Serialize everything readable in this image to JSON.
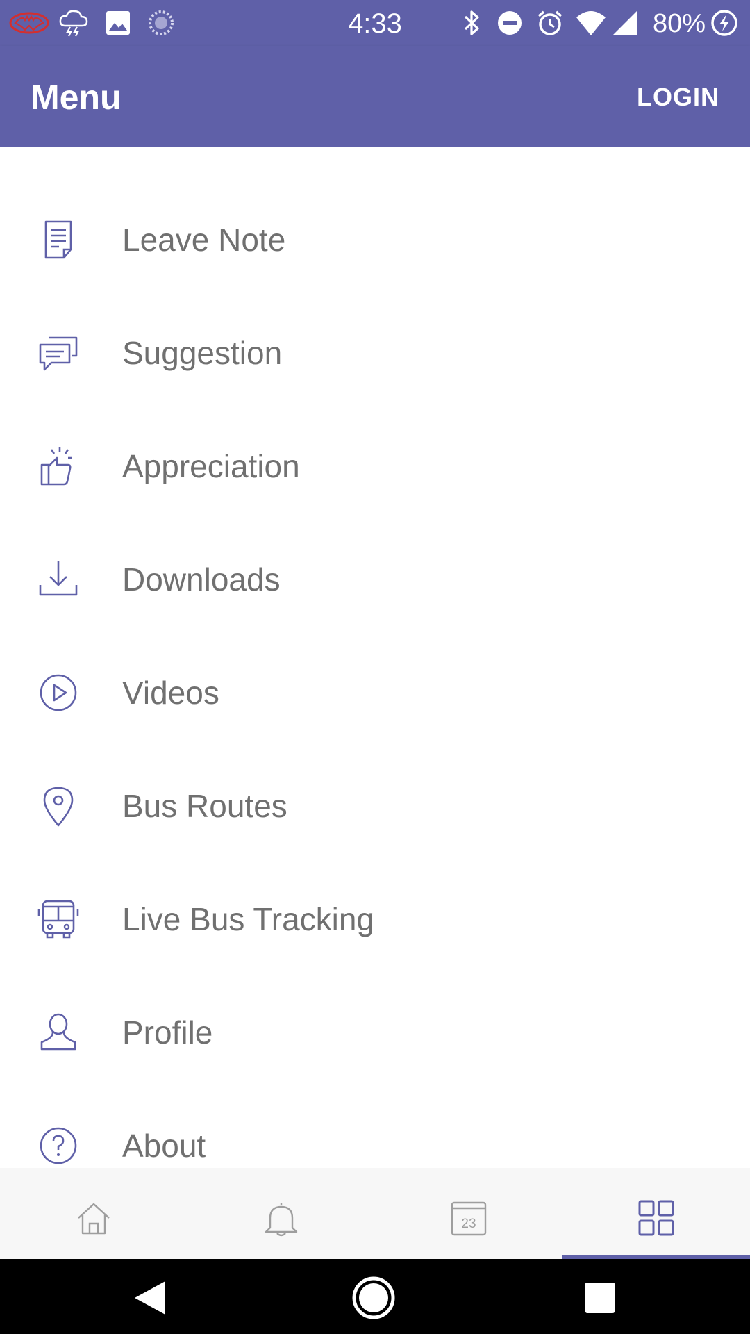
{
  "status_bar": {
    "time": "4:33",
    "battery_percent": "80%",
    "left_icons": [
      "batman-icon",
      "thunderstorm-icon",
      "image-icon",
      "sync-icon"
    ],
    "right_icons": [
      "bluetooth-icon",
      "do-not-disturb-icon",
      "alarm-icon",
      "wifi-icon",
      "signal-icon",
      "battery-charging-icon"
    ]
  },
  "app_bar": {
    "title": "Menu",
    "login_label": "LOGIN"
  },
  "menu": {
    "items": [
      {
        "label": "Leave Note",
        "icon": "document-icon"
      },
      {
        "label": "Suggestion",
        "icon": "chat-icon"
      },
      {
        "label": "Appreciation",
        "icon": "thumbs-up-icon"
      },
      {
        "label": "Downloads",
        "icon": "download-icon"
      },
      {
        "label": "Videos",
        "icon": "play-icon"
      },
      {
        "label": "Bus Routes",
        "icon": "location-pin-icon"
      },
      {
        "label": "Live Bus Tracking",
        "icon": "bus-icon"
      },
      {
        "label": "Profile",
        "icon": "person-icon"
      },
      {
        "label": "About",
        "icon": "help-icon"
      }
    ]
  },
  "bottom_nav": {
    "tabs": [
      {
        "icon": "home-icon",
        "active": false
      },
      {
        "icon": "bell-icon",
        "active": false
      },
      {
        "icon": "calendar-icon",
        "date_text": "23",
        "active": false
      },
      {
        "icon": "grid-icon",
        "active": true
      }
    ]
  },
  "system_nav": {
    "buttons": [
      "back-icon",
      "home-circle-icon",
      "recents-icon"
    ]
  },
  "colors": {
    "primary": "#5f60a8",
    "menu_text": "#707070",
    "icon_stroke": "#5f60a8",
    "inactive_icon": "#9e9e9e"
  }
}
